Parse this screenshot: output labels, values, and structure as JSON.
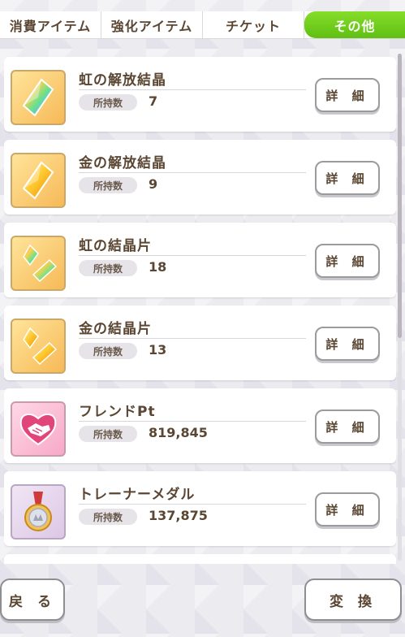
{
  "tabs": [
    {
      "label": "消費アイテム",
      "active": false
    },
    {
      "label": "強化アイテム",
      "active": false
    },
    {
      "label": "チケット",
      "active": false
    },
    {
      "label": "その他",
      "active": true
    }
  ],
  "items": [
    {
      "name": "虹の解放結晶",
      "qty_label": "所持数",
      "qty": "7",
      "detail": "詳 細",
      "icon": "rainbow-crystal-icon"
    },
    {
      "name": "金の解放結晶",
      "qty_label": "所持数",
      "qty": "9",
      "detail": "詳 細",
      "icon": "gold-crystal-icon"
    },
    {
      "name": "虹の結晶片",
      "qty_label": "所持数",
      "qty": "18",
      "detail": "詳 細",
      "icon": "rainbow-shard-icon"
    },
    {
      "name": "金の結晶片",
      "qty_label": "所持数",
      "qty": "13",
      "detail": "詳 細",
      "icon": "gold-shard-icon"
    },
    {
      "name": "フレンドPt",
      "qty_label": "所持数",
      "qty": "819,845",
      "detail": "詳 細",
      "icon": "handshake-icon"
    },
    {
      "name": "トレーナーメダル",
      "qty_label": "所持数",
      "qty": "137,875",
      "detail": "詳 細",
      "icon": "medal-icon"
    }
  ],
  "footer": {
    "back_label": "戻 る",
    "exchange_label": "変 換"
  },
  "colors": {
    "accent_green": "#6ccb1a",
    "text_brown": "#5a4632"
  }
}
